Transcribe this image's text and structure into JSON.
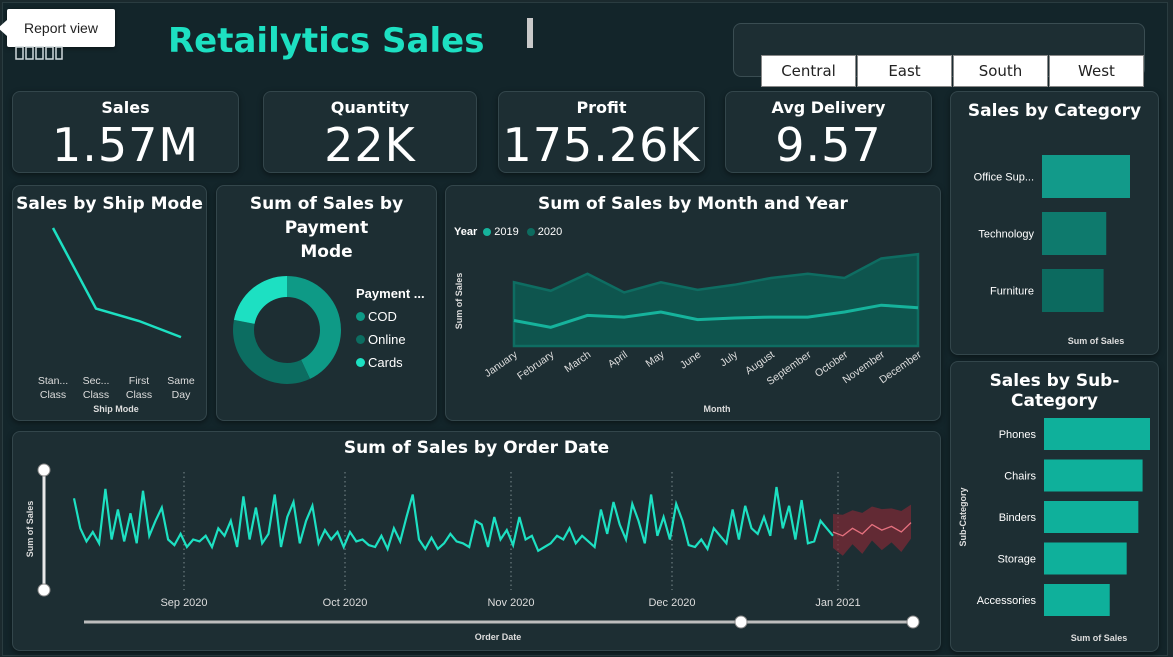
{
  "header": {
    "tooltip": "Report view",
    "title": "Retailytics Sales",
    "regions": [
      "Central",
      "East",
      "South",
      "West"
    ]
  },
  "kpis": [
    {
      "label": "Sales",
      "value": "1.57M"
    },
    {
      "label": "Quantity",
      "value": "22K"
    },
    {
      "label": "Profit",
      "value": "175.26K"
    },
    {
      "label": "Avg Delivery",
      "value": "9.57"
    }
  ],
  "ship_mode": {
    "title": "Sales by Ship Mode",
    "xlabel": "Ship Mode",
    "categories": [
      "Stan... Class",
      "Sec... Class",
      "First Class",
      "Same Day"
    ],
    "values": [
      100,
      35,
      25,
      12
    ]
  },
  "payment": {
    "title_line1": "Sum of Sales by Payment",
    "title_line2": "Mode",
    "legend_title": "Payment ...",
    "items": [
      {
        "name": "COD",
        "value": 43,
        "color": "#0e9a86"
      },
      {
        "name": "Online",
        "value": 35,
        "color": "#0c6d61"
      },
      {
        "name": "Cards",
        "value": 22,
        "color": "#1de0c2"
      }
    ]
  },
  "month_chart": {
    "title": "Sum of Sales by Month and Year",
    "legend_title": "Year",
    "series_names": [
      "2019",
      "2020"
    ],
    "colors": [
      "#16b39c",
      "#0d6b5f"
    ],
    "xlabel": "Month",
    "ylabel": "Sum of Sales",
    "months": [
      "January",
      "February",
      "March",
      "April",
      "May",
      "June",
      "July",
      "August",
      "September",
      "October",
      "November",
      "December"
    ],
    "series_2019": [
      30,
      22,
      36,
      34,
      40,
      31,
      33,
      34,
      34,
      40,
      48,
      45
    ],
    "series_2020": [
      75,
      65,
      85,
      63,
      75,
      66,
      72,
      80,
      85,
      80,
      103,
      108
    ]
  },
  "category": {
    "title": "Sales by Category",
    "xlabel": "Sum of Sales",
    "categories": [
      "Office Sup...",
      "Technology",
      "Furniture"
    ],
    "values": [
      100,
      73,
      70
    ],
    "colors": [
      "#129a8a",
      "#0e7a6d",
      "#0c6a5f"
    ]
  },
  "subcategory": {
    "title": "Sales by Sub-Category",
    "xlabel": "Sum of Sales",
    "ylabel": "Sub-Category",
    "categories": [
      "Phones",
      "Chairs",
      "Binders",
      "Storage",
      "Accessories"
    ],
    "values": [
      100,
      93,
      89,
      78,
      62
    ]
  },
  "order_date": {
    "title": "Sum of Sales by Order Date",
    "xlabel": "Order Date",
    "ylabel": "Sum of Sales",
    "tick_labels": [
      "Sep 2020",
      "Oct 2020",
      "Nov 2020",
      "Dec 2020",
      "Jan 2021"
    ],
    "values": [
      34,
      18,
      11,
      16,
      10,
      39,
      12,
      28,
      11,
      26,
      10,
      38,
      14,
      22,
      29,
      12,
      9,
      15,
      8,
      12,
      11,
      14,
      8,
      18,
      14,
      22,
      8,
      35,
      12,
      29,
      10,
      15,
      36,
      8,
      24,
      32,
      10,
      22,
      30,
      10,
      17,
      12,
      16,
      8,
      16,
      11,
      12,
      9,
      8,
      14,
      7,
      18,
      11,
      24,
      36,
      12,
      7,
      13,
      7,
      10,
      15,
      11,
      10,
      8,
      22,
      20,
      8,
      24,
      12,
      17,
      9,
      24,
      12,
      14,
      6,
      8,
      10,
      14,
      12,
      18,
      10,
      14,
      11,
      8,
      28,
      15,
      32,
      20,
      12,
      31,
      22,
      10,
      36,
      14,
      24,
      12,
      31,
      22,
      9,
      8,
      12,
      7,
      18,
      14,
      10,
      28,
      12,
      30,
      18,
      15,
      24,
      14,
      40,
      18,
      30,
      12,
      33,
      10,
      11,
      22,
      18,
      14
    ],
    "forecast": [
      16,
      14,
      18,
      15,
      20,
      17,
      19,
      16,
      21
    ]
  }
}
